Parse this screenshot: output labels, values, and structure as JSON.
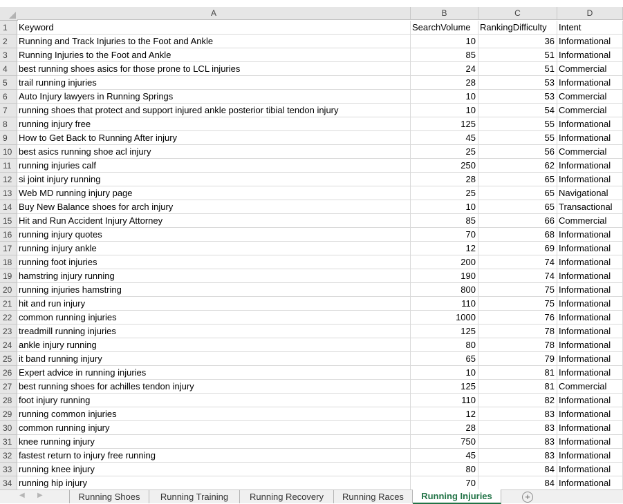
{
  "columns": [
    "A",
    "B",
    "C",
    "D"
  ],
  "header_row": {
    "num": "1",
    "keyword": "Keyword",
    "search_volume": "SearchVolume",
    "ranking_difficulty": "RankingDifficulty",
    "intent": "Intent"
  },
  "rows": [
    {
      "num": "2",
      "keyword": "Running and Track Injuries to the Foot and Ankle",
      "volume": "10",
      "difficulty": "36",
      "intent": "Informational"
    },
    {
      "num": "3",
      "keyword": "Running Injuries to the Foot and Ankle",
      "volume": "85",
      "difficulty": "51",
      "intent": "Informational"
    },
    {
      "num": "4",
      "keyword": "best running shoes asics for those prone to LCL injuries",
      "volume": "24",
      "difficulty": "51",
      "intent": "Commercial"
    },
    {
      "num": "5",
      "keyword": "trail running injuries",
      "volume": "28",
      "difficulty": "53",
      "intent": "Informational"
    },
    {
      "num": "6",
      "keyword": "Auto Injury lawyers in Running Springs",
      "volume": "10",
      "difficulty": "53",
      "intent": "Commercial"
    },
    {
      "num": "7",
      "keyword": "running shoes that protect and support injured ankle posterior tibial tendon injury",
      "volume": "10",
      "difficulty": "54",
      "intent": "Commercial"
    },
    {
      "num": "8",
      "keyword": "running injury free",
      "volume": "125",
      "difficulty": "55",
      "intent": "Informational"
    },
    {
      "num": "9",
      "keyword": "How to Get Back to Running After injury",
      "volume": "45",
      "difficulty": "55",
      "intent": "Informational"
    },
    {
      "num": "10",
      "keyword": "best asics running shoe acl injury",
      "volume": "25",
      "difficulty": "56",
      "intent": "Commercial"
    },
    {
      "num": "11",
      "keyword": "running injuries calf",
      "volume": "250",
      "difficulty": "62",
      "intent": "Informational"
    },
    {
      "num": "12",
      "keyword": "si joint injury running",
      "volume": "28",
      "difficulty": "65",
      "intent": "Informational"
    },
    {
      "num": "13",
      "keyword": "Web MD running injury page",
      "volume": "25",
      "difficulty": "65",
      "intent": "Navigational"
    },
    {
      "num": "14",
      "keyword": "Buy New Balance shoes for arch injury",
      "volume": "10",
      "difficulty": "65",
      "intent": "Transactional"
    },
    {
      "num": "15",
      "keyword": "Hit and Run Accident Injury Attorney",
      "volume": "85",
      "difficulty": "66",
      "intent": "Commercial"
    },
    {
      "num": "16",
      "keyword": "running injury quotes",
      "volume": "70",
      "difficulty": "68",
      "intent": "Informational"
    },
    {
      "num": "17",
      "keyword": "running injury ankle",
      "volume": "12",
      "difficulty": "69",
      "intent": "Informational"
    },
    {
      "num": "18",
      "keyword": "running foot injuries",
      "volume": "200",
      "difficulty": "74",
      "intent": "Informational"
    },
    {
      "num": "19",
      "keyword": "hamstring injury running",
      "volume": "190",
      "difficulty": "74",
      "intent": "Informational"
    },
    {
      "num": "20",
      "keyword": "running injuries hamstring",
      "volume": "800",
      "difficulty": "75",
      "intent": "Informational"
    },
    {
      "num": "21",
      "keyword": "hit and run injury",
      "volume": "110",
      "difficulty": "75",
      "intent": "Informational"
    },
    {
      "num": "22",
      "keyword": "common running injuries",
      "volume": "1000",
      "difficulty": "76",
      "intent": "Informational"
    },
    {
      "num": "23",
      "keyword": "treadmill running injuries",
      "volume": "125",
      "difficulty": "78",
      "intent": "Informational"
    },
    {
      "num": "24",
      "keyword": "ankle injury running",
      "volume": "80",
      "difficulty": "78",
      "intent": "Informational"
    },
    {
      "num": "25",
      "keyword": "it band running injury",
      "volume": "65",
      "difficulty": "79",
      "intent": "Informational"
    },
    {
      "num": "26",
      "keyword": "Expert advice in running injuries",
      "volume": "10",
      "difficulty": "81",
      "intent": "Informational"
    },
    {
      "num": "27",
      "keyword": "best running shoes for achilles tendon injury",
      "volume": "125",
      "difficulty": "81",
      "intent": "Commercial"
    },
    {
      "num": "28",
      "keyword": "foot injury running",
      "volume": "110",
      "difficulty": "82",
      "intent": "Informational"
    },
    {
      "num": "29",
      "keyword": "running common injuries",
      "volume": "12",
      "difficulty": "83",
      "intent": "Informational"
    },
    {
      "num": "30",
      "keyword": "common running injury",
      "volume": "28",
      "difficulty": "83",
      "intent": "Informational"
    },
    {
      "num": "31",
      "keyword": "knee running injury",
      "volume": "750",
      "difficulty": "83",
      "intent": "Informational"
    },
    {
      "num": "32",
      "keyword": "fastest return to injury free running",
      "volume": "45",
      "difficulty": "83",
      "intent": "Informational"
    },
    {
      "num": "33",
      "keyword": "running knee injury",
      "volume": "80",
      "difficulty": "84",
      "intent": "Informational"
    },
    {
      "num": "34",
      "keyword": "running hip injury",
      "volume": "70",
      "difficulty": "84",
      "intent": "Informational"
    }
  ],
  "sheet_tabs": [
    {
      "label": "Running Shoes",
      "active": false
    },
    {
      "label": "Running Training",
      "active": false
    },
    {
      "label": "Running Recovery",
      "active": false
    },
    {
      "label": "Running Races",
      "active": false
    },
    {
      "label": "Running Injuries",
      "active": true
    }
  ],
  "add_sheet_symbol": "+",
  "accent_color": "#217346"
}
